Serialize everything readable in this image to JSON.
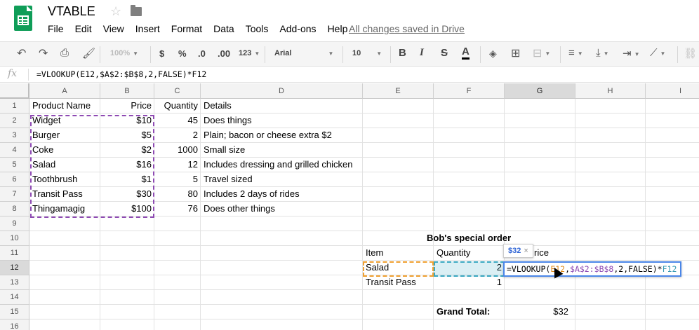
{
  "app": {
    "title": "VTABLE",
    "saved_status": "All changes saved in Drive",
    "menu": [
      "File",
      "Edit",
      "View",
      "Insert",
      "Format",
      "Data",
      "Tools",
      "Add-ons",
      "Help"
    ]
  },
  "toolbar": {
    "zoom": "100%",
    "currency": "$",
    "percent": "%",
    "dec_less": ".0",
    "dec_more": ".00",
    "number_format": "123",
    "font": "Arial",
    "font_size": "10",
    "bold": "B",
    "italic": "I",
    "strike": "S",
    "text_color": "A"
  },
  "formula_bar": {
    "fx": "fx",
    "text": "=VLOOKUP(E12,$A$2:$B$8,2,FALSE)*F12"
  },
  "columns": [
    "A",
    "B",
    "C",
    "D",
    "E",
    "F",
    "G",
    "H",
    "I"
  ],
  "rows": [
    "1",
    "2",
    "3",
    "4",
    "5",
    "6",
    "7",
    "8",
    "9",
    "10",
    "11",
    "12",
    "13",
    "14",
    "15",
    "16"
  ],
  "cells": {
    "A1": "Product Name",
    "B1": "Price",
    "C1": "Quantity",
    "D1": "Details",
    "A2": "Widget",
    "B2": "$10",
    "C2": "45",
    "D2": "Does things",
    "A3": "Burger",
    "B3": "$5",
    "C3": "2",
    "D3": "Plain; bacon or cheese extra $2",
    "A4": "Coke",
    "B4": "$2",
    "C4": "1000",
    "D4": "Small size",
    "A5": "Salad",
    "B5": "$16",
    "C5": "12",
    "D5": "Includes dressing and grilled chicken",
    "A6": "Toothbrush",
    "B6": "$1",
    "C6": "5",
    "D6": "Travel sized",
    "A7": "Transit Pass",
    "B7": "$30",
    "C7": "80",
    "D7": "Includes 2 days of rides",
    "A8": "Thingamagig",
    "B8": "$100",
    "C8": "76",
    "D8": "Does other things",
    "F10": "Bob's special order",
    "E11": "Item",
    "F11": "Quantity",
    "G11": "rice",
    "E12": "Salad",
    "F12": "2",
    "E13": "Transit Pass",
    "F13": "1",
    "F15": "Grand Total:",
    "G15": "$32"
  },
  "editor": {
    "p1": "=VLOOKUP(",
    "p2": "E12",
    "p3": ",",
    "p4": "$A$2:$B$8",
    "p5": ",2,FALSE)*",
    "p6": "F12"
  },
  "tooltip": {
    "value": "$32",
    "close": "×"
  },
  "colors": {
    "range_purple": "#8e4ab3",
    "range_orange": "#f0a030",
    "range_teal": "#3aa8c1",
    "active_blue": "#4a86e8",
    "sheets_green": "#0f9d58"
  }
}
